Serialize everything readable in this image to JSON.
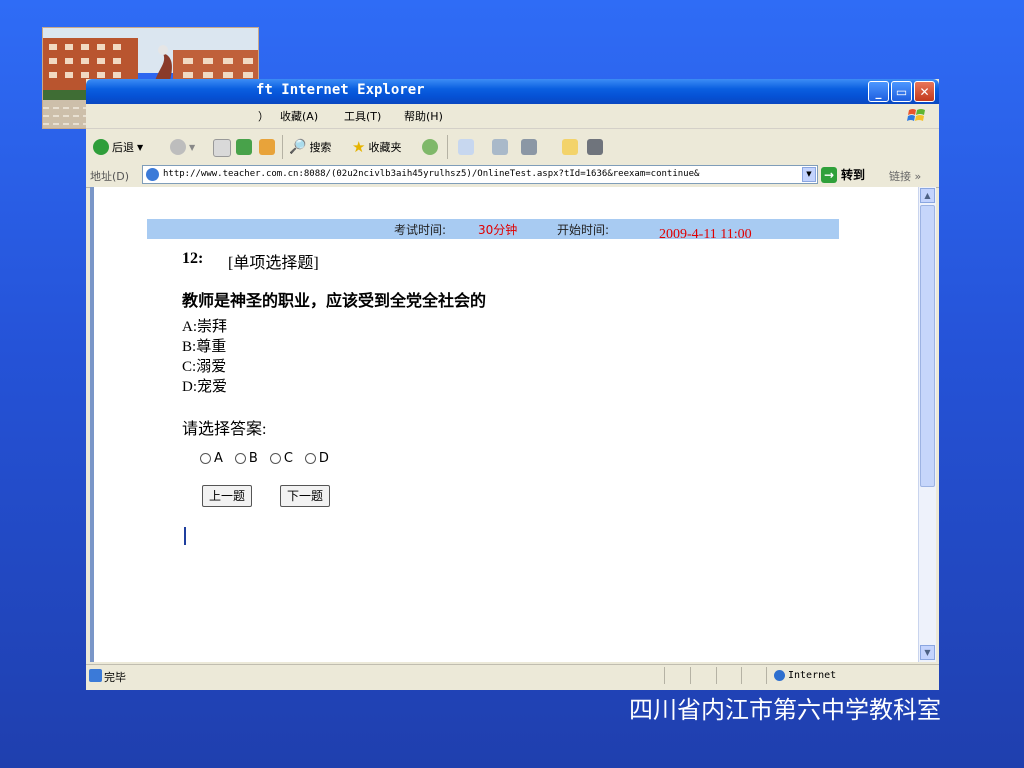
{
  "window": {
    "title": "ft Internet Explorer",
    "buttons": [
      "_",
      "▭",
      "✕"
    ]
  },
  "menu": [
    "）",
    "收藏(A)",
    "工具(T)",
    "帮助(H)"
  ],
  "toolbar": {
    "back": "后退",
    "search": "搜索",
    "favorites": "收藏夹"
  },
  "address": {
    "label": "地址(D)",
    "url": "http://www.teacher.com.cn:8088/(02u2ncivlb3aih45yrulhsz5)/OnlineTest.aspx?tId=1636&reexam=continue&",
    "go": "转到",
    "links": "链接",
    "more": "»"
  },
  "exam": {
    "time_label": "考试时间:",
    "time_value": "30分钟",
    "start_label": "开始时间:",
    "start_value": "2009-4-11   11:00",
    "question_number": "12:",
    "question_type": "[单项选择题]",
    "question_text": "教师是神圣的职业，应该受到全党全社会的",
    "options": [
      {
        "key": "A:",
        "text": "崇拜"
      },
      {
        "key": "B:",
        "text": "尊重"
      },
      {
        "key": "C:",
        "text": "溺爱"
      },
      {
        "key": "D:",
        "text": "宠爱"
      }
    ],
    "prompt": "请选择答案:",
    "choices": [
      "A",
      "B",
      "C",
      "D"
    ],
    "prev_button": "上一题",
    "next_button": "下一题"
  },
  "status": {
    "text": "完毕",
    "zone": "Internet"
  },
  "footer": "四川省内江市第六中学教科室",
  "colors": {
    "background": "#2553d8",
    "titlebar": "#0a5fe0",
    "timebar": "#a8cbf2",
    "accent_red": "#e00000"
  }
}
